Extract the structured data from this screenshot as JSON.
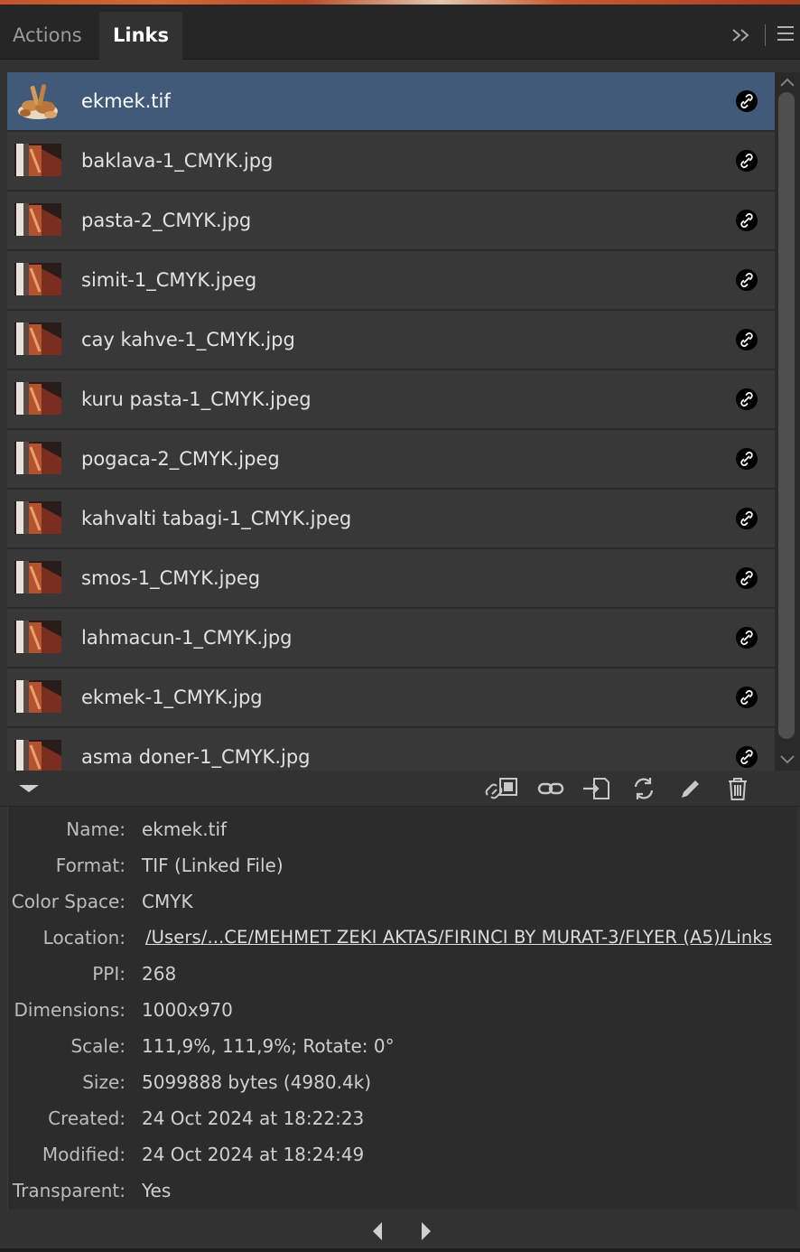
{
  "tabs": {
    "actions": "Actions",
    "links": "Links"
  },
  "links": [
    {
      "name": "ekmek.tif",
      "selected": true,
      "thumb": "bread-thumbnail"
    },
    {
      "name": "baklava-1_CMYK.jpg",
      "thumb": "image-thumbnail"
    },
    {
      "name": "pasta-2_CMYK.jpg",
      "thumb": "image-thumbnail"
    },
    {
      "name": "simit-1_CMYK.jpeg",
      "thumb": "image-thumbnail"
    },
    {
      "name": "cay kahve-1_CMYK.jpg",
      "thumb": "image-thumbnail"
    },
    {
      "name": "kuru pasta-1_CMYK.jpeg",
      "thumb": "image-thumbnail"
    },
    {
      "name": "pogaca-2_CMYK.jpeg",
      "thumb": "image-thumbnail"
    },
    {
      "name": "kahvalti tabagi-1_CMYK.jpeg",
      "thumb": "image-thumbnail"
    },
    {
      "name": "smos-1_CMYK.jpeg",
      "thumb": "image-thumbnail"
    },
    {
      "name": "lahmacun-1_CMYK.jpg",
      "thumb": "image-thumbnail"
    },
    {
      "name": "ekmek-1_CMYK.jpg",
      "thumb": "image-thumbnail"
    },
    {
      "name": "asma doner-1_CMYK.jpg",
      "thumb": "image-thumbnail"
    }
  ],
  "toolbar_icons": [
    "relink-from-libraries-icon",
    "relink-icon",
    "go-to-link-icon",
    "update-link-icon",
    "edit-original-icon",
    "trash-icon"
  ],
  "info": {
    "name_label": "Name:",
    "name": "ekmek.tif",
    "format_label": "Format:",
    "format": "TIF (Linked File)",
    "colorspace_label": "Color Space:",
    "colorspace": "CMYK",
    "location_label": "Location:",
    "location": "/Users/...CE/MEHMET ZEKI AKTAS/FIRINCI BY MURAT-3/FLYER (A5)/Links",
    "ppi_label": "PPI:",
    "ppi": "268",
    "dimensions_label": "Dimensions:",
    "dimensions": "1000x970",
    "scale_label": "Scale:",
    "scale": "111,9%, 111,9%; Rotate: 0°",
    "size_label": "Size:",
    "size": "5099888 bytes (4980.4k)",
    "created_label": "Created:",
    "created": "24 Oct 2024 at 18:22:23",
    "modified_label": "Modified:",
    "modified": "24 Oct 2024 at 18:24:49",
    "transparent_label": "Transparent:",
    "transparent": "Yes"
  },
  "colors": {
    "selected_row": "#415a7a",
    "panel_bg": "#323232",
    "row_bg": "#383838"
  }
}
